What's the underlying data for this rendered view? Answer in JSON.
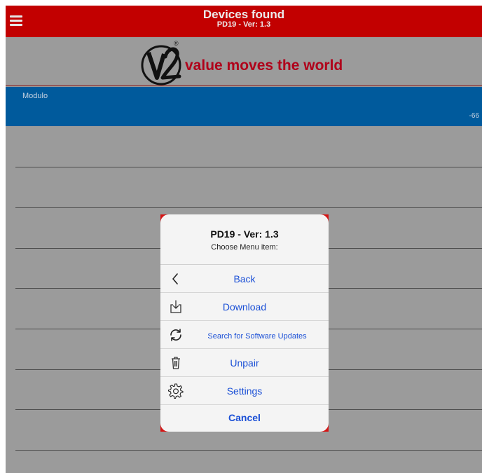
{
  "header": {
    "title": "Devices found",
    "subtitle": "PD19 - Ver: 1.3",
    "menu_icon": "hamburger-icon",
    "bar_color": "#c20000"
  },
  "brand": {
    "logo_icon": "v2-logo",
    "logo_text": "V2",
    "registered_mark": "®",
    "tagline": "value moves the world",
    "tagline_color": "#b0001a"
  },
  "devices": [
    {
      "name": "Modulo",
      "rssi": "-66",
      "row_color": "#005a9c"
    }
  ],
  "menu": {
    "title": "PD19 - Ver: 1.3",
    "subtitle": "Choose Menu item:",
    "items": [
      {
        "label": "Back",
        "icon": "chevron-left-icon"
      },
      {
        "label": "Download",
        "icon": "download-icon"
      },
      {
        "label": "Search for Software Updates",
        "icon": "refresh-icon"
      },
      {
        "label": "Unpair",
        "icon": "trash-icon"
      },
      {
        "label": "Settings",
        "icon": "gear-icon"
      }
    ],
    "cancel_label": "Cancel",
    "link_color": "#1a4fd6"
  }
}
